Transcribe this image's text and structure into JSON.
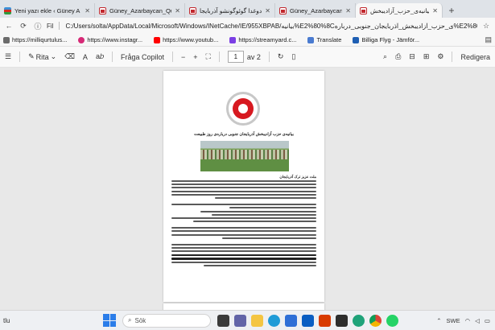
{
  "tabs": [
    {
      "label": "Yeni yazı ekle ‹ Güney A",
      "favicon": "flag-icon",
      "active": false
    },
    {
      "label": "Güney_Azarbaycan_Qu",
      "favicon": "pdf-icon",
      "active": false
    },
    {
      "label": "دوغدا گوئوگونشو آذربایجا",
      "favicon": "pdf-icon",
      "active": false
    },
    {
      "label": "Güney_Azarbaycan_Ku",
      "favicon": "pdf-icon",
      "active": false
    },
    {
      "label": "بیانیه‌ی_حزب_آزادیبخش",
      "favicon": "pdf-icon",
      "active": true
    }
  ],
  "address": {
    "file_label": "Fil",
    "url": "C:/Users/solta/AppData/Local/Microsoft/Windows/INetCache/IE/955XBPAB/بیانیه%E2%80%8Cی_حزب_آزادیبخش_آذربایجان_جنوبی_درباره%E2%80%8C"
  },
  "bookmarks": [
    {
      "label": "https://milliqurtulus...",
      "color": "#6b6b6b"
    },
    {
      "label": "https://www.instagr...",
      "color": "#d62976"
    },
    {
      "label": "https://www.youtub...",
      "color": "#ff0000"
    },
    {
      "label": "https://streamyard.c...",
      "color": "#7b3fe4"
    },
    {
      "label": "Translate",
      "color": "#4a7bd0"
    },
    {
      "label": "Billiga Flyg - Jämför...",
      "color": "#1f5fb3"
    }
  ],
  "pdf_toolbar": {
    "draw_label": "Rita",
    "copilot_label": "Fråga Copilot",
    "zoom_minus": "−",
    "zoom_plus": "+",
    "page_current": "1",
    "page_total": "av 2",
    "edit_label": "Redigera"
  },
  "document": {
    "title": "بیانیه‌ی حزب آزادیبخش آذربایجان جنوبی درباره‌ی روز طبیعت",
    "addressee": "ملت عزیز ترک آذربایجان"
  },
  "taskbar": {
    "left_text": "tlu",
    "search_placeholder": "Sök",
    "language": "SWE"
  }
}
